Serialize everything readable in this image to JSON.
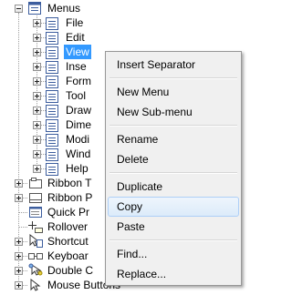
{
  "tree": {
    "root_label": "Menus",
    "menu_items": [
      {
        "label": "File"
      },
      {
        "label": "Edit"
      },
      {
        "label": "View",
        "selected": true
      },
      {
        "label": "Inse"
      },
      {
        "label": "Form"
      },
      {
        "label": "Tool"
      },
      {
        "label": "Draw"
      },
      {
        "label": "Dime"
      },
      {
        "label": "Modi"
      },
      {
        "label": "Wind"
      },
      {
        "label": "Help"
      }
    ],
    "nodes": [
      {
        "label": "Ribbon T",
        "icon": "ribbon-tab-icon",
        "expander": "plus"
      },
      {
        "label": "Ribbon P",
        "icon": "ribbon-panel-icon",
        "expander": "plus"
      },
      {
        "label": "Quick Pr",
        "icon": "quick-properties-icon",
        "expander": "none"
      },
      {
        "label": "Rollover",
        "icon": "rollover-tooltip-icon",
        "expander": "none"
      },
      {
        "label": "Shortcut",
        "icon": "shortcut-menu-icon",
        "expander": "plus"
      },
      {
        "label": "Keyboar",
        "icon": "keyboard-shortcut-icon",
        "expander": "plus"
      },
      {
        "label": "Double C",
        "icon": "double-click-icon",
        "expander": "plus"
      },
      {
        "label": "Mouse Buttons",
        "icon": "mouse-buttons-icon",
        "expander": "plus"
      }
    ]
  },
  "context_menu": {
    "items": [
      {
        "label": "Insert Separator"
      },
      {
        "separator": true
      },
      {
        "label": "New Menu"
      },
      {
        "label": "New Sub-menu"
      },
      {
        "separator": true
      },
      {
        "label": "Rename"
      },
      {
        "label": "Delete"
      },
      {
        "separator": true
      },
      {
        "label": "Duplicate"
      },
      {
        "label": "Copy",
        "highlighted": true
      },
      {
        "label": "Paste"
      },
      {
        "separator": true
      },
      {
        "label": "Find..."
      },
      {
        "label": "Replace..."
      }
    ]
  },
  "colors": {
    "selection": "#3399ff",
    "menu_icon_border": "#3d5e9e",
    "menu_bg": "#f0f0f0",
    "hover_border": "#aecff7"
  }
}
